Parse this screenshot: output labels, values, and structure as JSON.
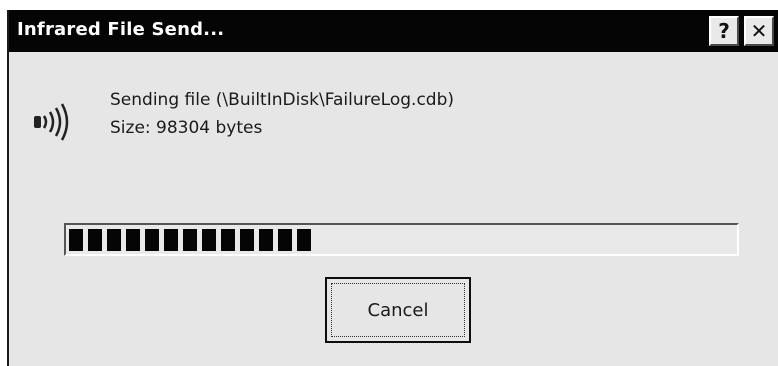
{
  "window": {
    "title": "Infrared File Send...",
    "help_label": "?",
    "close_label": "✕"
  },
  "message": {
    "file_line": "Sending file (\\BuiltInDisk\\FailureLog.cdb)",
    "size_line": "Size: 98304 bytes"
  },
  "progress": {
    "fraction": 0.36,
    "block_count": 13
  },
  "buttons": {
    "cancel_label": "Cancel"
  },
  "icons": {
    "status": "infrared-signal-icon"
  }
}
